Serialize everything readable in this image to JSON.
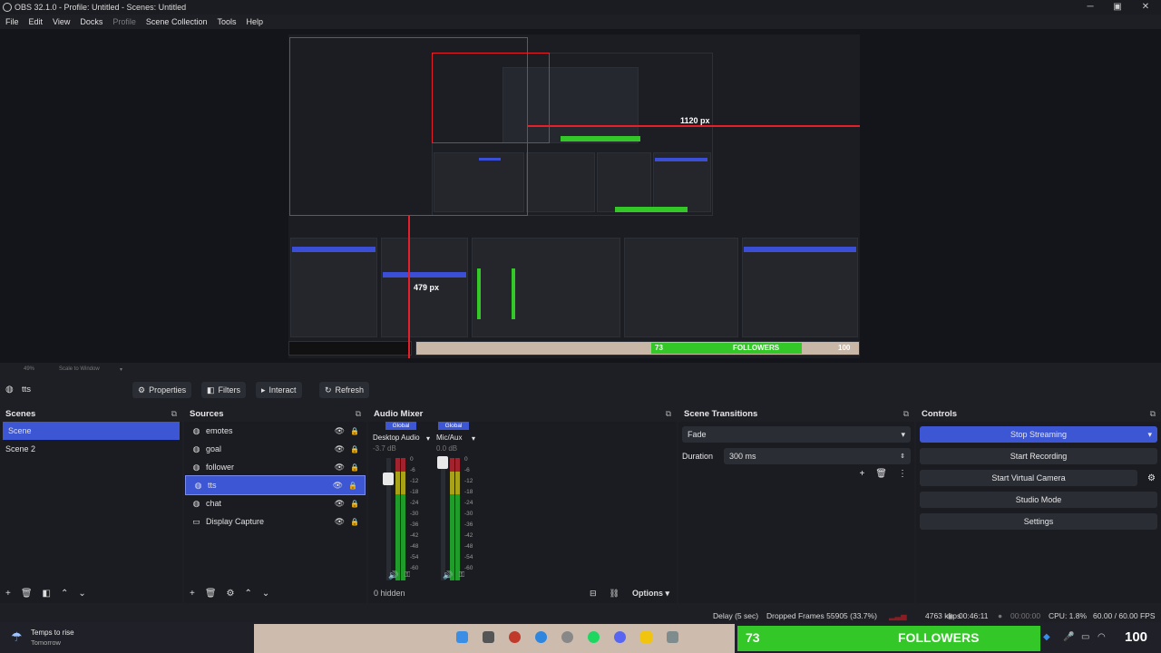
{
  "window": {
    "title": "OBS 32.1.0 - Profile: Untitled - Scenes: Untitled"
  },
  "menu": [
    "File",
    "Edit",
    "View",
    "Docks",
    "Profile",
    "Scene Collection",
    "Tools",
    "Help"
  ],
  "preview": {
    "label_width": "1120 px",
    "label_height": "479 px",
    "zoom_level": "49%",
    "scale_mode": "Scale to Window",
    "overlay_count": "73",
    "overlay_text": "FOLLOWERS",
    "overlay_corner": "100"
  },
  "source_toolbar": {
    "current_source": "tts",
    "buttons": [
      "Properties",
      "Filters",
      "Interact",
      "Refresh"
    ]
  },
  "scenes": {
    "title": "Scenes",
    "items": [
      "Scene",
      "Scene 2"
    ],
    "selected": 0
  },
  "sources": {
    "title": "Sources",
    "items": [
      {
        "name": "emotes",
        "icon": "browser-icon"
      },
      {
        "name": "goal",
        "icon": "browser-icon"
      },
      {
        "name": "follower",
        "icon": "browser-icon"
      },
      {
        "name": "tts",
        "icon": "browser-icon"
      },
      {
        "name": "chat",
        "icon": "browser-icon"
      },
      {
        "name": "Display Capture",
        "icon": "monitor-icon"
      }
    ],
    "selected": 3
  },
  "audio_mixer": {
    "title": "Audio Mixer",
    "channels": [
      {
        "tag": "Global",
        "name": "Desktop Audio",
        "db": "-3.7 dB",
        "level": 0.72
      },
      {
        "tag": "Global",
        "name": "Mic/Aux",
        "db": "0.0 dB",
        "level": 0.9
      }
    ],
    "ticks": [
      "0",
      "-6",
      "-12",
      "-18",
      "-24",
      "-30",
      "-36",
      "-42",
      "-48",
      "-54",
      "-60"
    ],
    "hidden_label": "0 hidden",
    "options_label": "Options"
  },
  "transitions": {
    "title": "Scene Transitions",
    "selected": "Fade",
    "duration_label": "Duration",
    "duration_value": "300 ms"
  },
  "controls": {
    "title": "Controls",
    "buttons": [
      "Stop Streaming",
      "Start Recording",
      "Start Virtual Camera",
      "Studio Mode",
      "Settings"
    ]
  },
  "status": {
    "delay": "Delay (5 sec)",
    "dropped": "Dropped Frames 55905 (33.7%)",
    "bitrate": "4763 kbps",
    "stream_time": "00:46:11",
    "rec_time": "00:00:00",
    "cpu": "CPU: 1.8%",
    "fps": "60.00 / 60.00 FPS"
  },
  "taskbar": {
    "weather_title": "Temps to rise",
    "weather_sub": "Tomorrow",
    "followers_count": "73",
    "followers_label": "FOLLOWERS",
    "corner_num": "100"
  },
  "colors": {
    "accent": "#3d56d4",
    "guide_red": "#e5202a",
    "followers_green": "#33c728"
  }
}
